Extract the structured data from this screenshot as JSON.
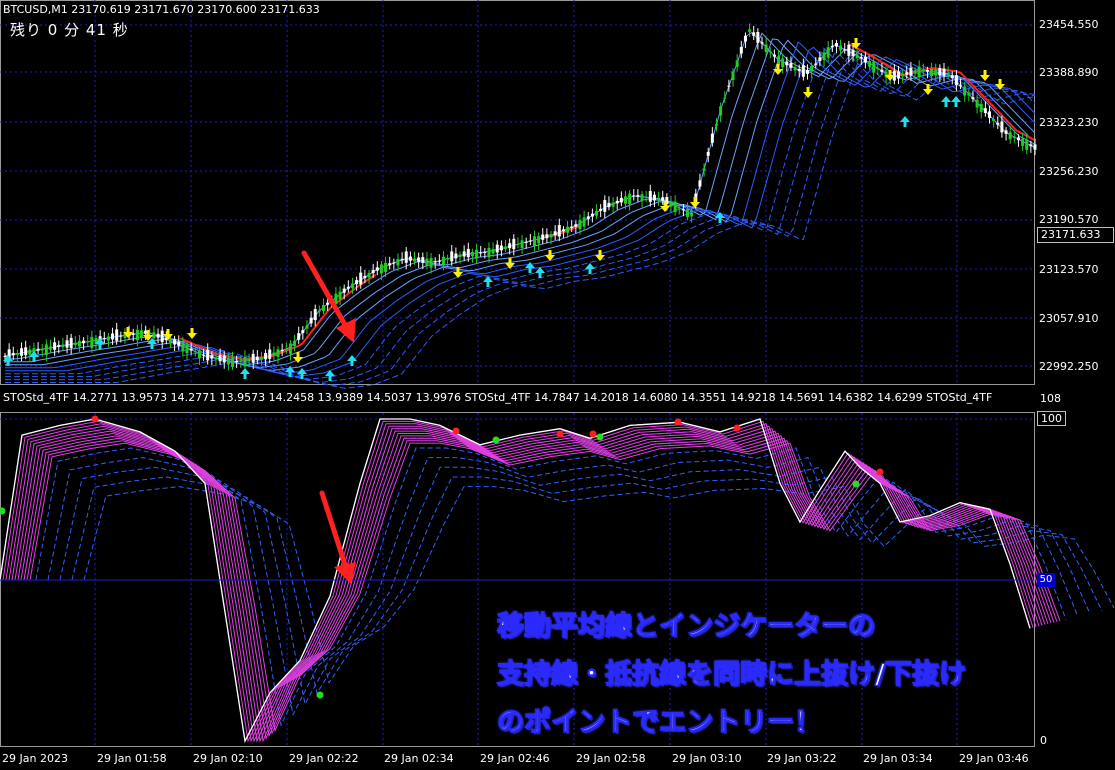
{
  "main_chart": {
    "symbol_info": "BTCUSD,M1  23170.619 23171.670 23170.600 23171.633",
    "countdown": "残り  0 分  41 秒",
    "price_labels": [
      "23454.550",
      "23388.890",
      "23323.230",
      "23256.230",
      "23190.570",
      "23123.570",
      "23057.910",
      "22992.250"
    ],
    "current_price": "23171.633"
  },
  "sub_window": {
    "header": "STOStd_4TF 14.2771 13.9573 14.2771 13.9573 14.2458 13.9389 14.5037 13.9976   STOStd_4TF 14.7847 14.2018 14.6080 14.3551 14.9218 14.5691 14.6382 14.6299   STOStd_4TF",
    "scale_max": "108",
    "level_100": "100",
    "scale_min": "0",
    "level_box": "50"
  },
  "time_axis": [
    "29 Jan 2023",
    "29 Jan 01:58",
    "29 Jan 02:10",
    "29 Jan 02:22",
    "29 Jan 02:34",
    "29 Jan 02:46",
    "29 Jan 02:58",
    "29 Jan 03:10",
    "29 Jan 03:22",
    "29 Jan 03:34",
    "29 Jan 03:46"
  ],
  "caption": {
    "line1": "移動平均線とインジケーターの",
    "line2": "支持線・抵抗線を同時に上抜け/下抜け",
    "line3": "のポイントでエントリー！"
  },
  "colors": {
    "background": "#000000",
    "grid": "#1e1ecf",
    "bull_candle": "#22cc22",
    "bear_candle": "#ffffff",
    "arrow": "#ff2020",
    "up_signal": "#22ddee",
    "down_signal": "#ffee00",
    "stoch_main": "#e040e0",
    "stoch_blue": "#3060ff"
  },
  "chart_data": {
    "type": "line",
    "series": [
      {
        "name": "",
        "values": [
          22998,
          23005,
          23012,
          23018,
          23025,
          23030,
          23015,
          22998,
          22990,
          22995,
          23010,
          23060,
          23090,
          23115,
          23130,
          23125,
          23135,
          23140,
          23150,
          23160,
          23175,
          23200,
          23215,
          23210,
          23190,
          23330,
          23440,
          23400,
          23380,
          23420,
          23400,
          23375,
          23385,
          23380,
          23340,
          23300,
          23280
        ]
      }
    ],
    "ylim": [
      22960,
      23480
    ]
  }
}
